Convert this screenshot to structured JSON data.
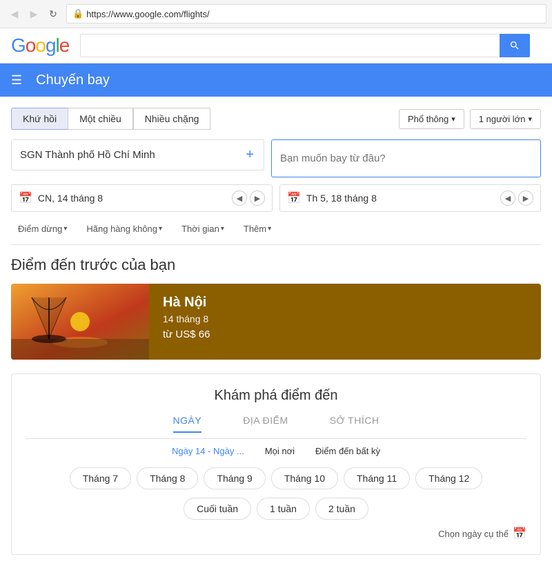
{
  "browser": {
    "url": "https://www.google.com/flights/",
    "back_label": "◀",
    "forward_label": "▶",
    "refresh_label": "↻",
    "lock_icon": "🔒"
  },
  "header": {
    "logo": {
      "G": "G",
      "o1": "o",
      "o2": "o",
      "g": "g",
      "l": "l",
      "e": "e"
    },
    "search_placeholder": ""
  },
  "navbar": {
    "hamburger_label": "☰",
    "title": "Chuyến bay"
  },
  "trip_types": {
    "round_trip": "Khứ hồi",
    "one_way": "Một chiều",
    "multi_city": "Nhiều chặng",
    "cabin_class": "Phổ thông",
    "passengers": "1 người lớn"
  },
  "route": {
    "origin": "SGN Thành phố Hồ Chí Minh",
    "add_icon": "+",
    "dest_placeholder": "Bạn muốn bay từ đâu?"
  },
  "dates": {
    "depart": {
      "icon": "📅",
      "value": "CN, 14 tháng 8"
    },
    "return": {
      "icon": "📅",
      "value": "Th 5, 18 tháng 8"
    },
    "prev": "◀",
    "next": "▶"
  },
  "filters": {
    "items": [
      "Điểm dừng",
      "Hãng hàng không",
      "Thời gian",
      "Thêm"
    ]
  },
  "previous_section": {
    "title": "Điểm đến trước của bạn",
    "card": {
      "city": "Hà Nội",
      "date": "14 tháng 8",
      "price": "từ US$ 66"
    }
  },
  "explore_section": {
    "title": "Khám phá điểm đến",
    "tabs": [
      {
        "label": "NGÀY",
        "active": true
      },
      {
        "label": "ĐỊA ĐIỂM",
        "active": false
      },
      {
        "label": "SỞ THÍCH",
        "active": false
      }
    ],
    "tab_values": [
      {
        "value": "Ngày 14 - Ngày ...",
        "active": true
      },
      {
        "value": "Mọi nơi",
        "active": false
      },
      {
        "value": "Điểm đến bất kỳ",
        "active": false
      }
    ],
    "months": [
      "Tháng 7",
      "Tháng 8",
      "Tháng 9",
      "Tháng 10",
      "Tháng 11",
      "Tháng 12"
    ],
    "durations": [
      "Cuối tuần",
      "1 tuần",
      "2 tuần"
    ],
    "footer_label": "Chọn ngày cụ thể",
    "calendar_icon": "📅"
  }
}
